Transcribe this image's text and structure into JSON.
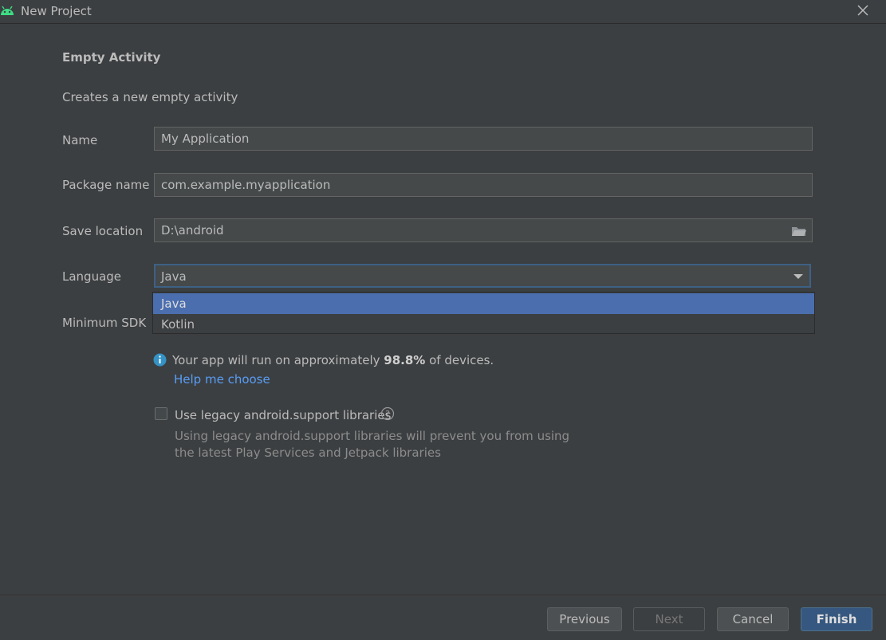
{
  "window": {
    "title": "New Project",
    "app_icon": "android-icon",
    "close_icon": "close-icon"
  },
  "form": {
    "heading": "Empty Activity",
    "description": "Creates a new empty activity",
    "name": {
      "label": "Name",
      "value": "My Application"
    },
    "package": {
      "label": "Package name",
      "value": "com.example.myapplication"
    },
    "location": {
      "label": "Save location",
      "value": "D:\\android",
      "icon": "folder-icon"
    },
    "language": {
      "label": "Language",
      "value": "Java",
      "options": [
        "Java",
        "Kotlin"
      ],
      "selected_index": 0
    },
    "min_sdk": {
      "label": "Minimum SDK"
    }
  },
  "info": {
    "icon": "info-icon",
    "text_before": "Your app will run on approximately ",
    "percentage": "98.8%",
    "text_after": " of devices.",
    "help_link": "Help me choose"
  },
  "legacy": {
    "checked": false,
    "label": "Use legacy android.support libraries",
    "help_icon": "question-icon",
    "hint_line1": "Using legacy android.support libraries will prevent you from using",
    "hint_line2": "the latest Play Services and Jetpack libraries"
  },
  "buttons": {
    "previous": "Previous",
    "next": "Next",
    "cancel": "Cancel",
    "finish": "Finish"
  },
  "colors": {
    "background": "#3c3f41",
    "field_background": "#45494a",
    "selection": "#4b6eaf",
    "link": "#589df6",
    "primary_button": "#365880"
  }
}
